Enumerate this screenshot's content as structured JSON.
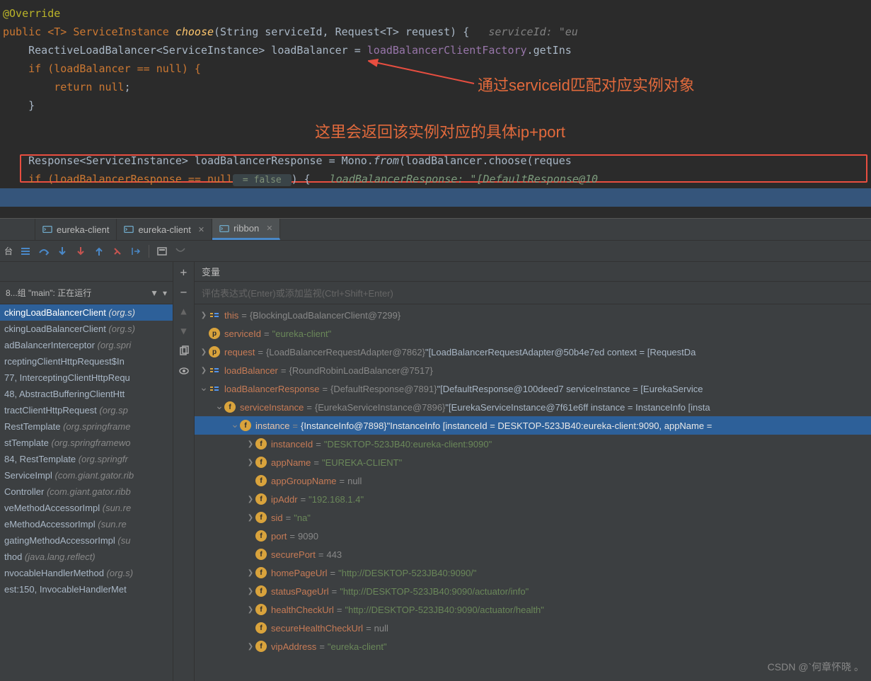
{
  "annotations": {
    "ann1": "通过serviceid匹配对应实例对象",
    "ann2": "这里会返回该实例对应的具体ip+port"
  },
  "code": {
    "override": "@Override",
    "line1_pre": "public <T> ServiceInstance ",
    "line1_method": "choose",
    "line1_post": "(String serviceId, Request<T> request) {",
    "line1_hint": "   serviceId: \"eu",
    "line2_pre": "    ReactiveLoadBalancer<ServiceInstance> loadBalancer = ",
    "line2_call": "loadBalancerClientFactory",
    "line2_post": ".getIns",
    "line3": "    if (loadBalancer == null) {",
    "line4_kw": "        return ",
    "line4_null": "null",
    "line4_end": ";",
    "line5": "    }",
    "line6_pre": "    Response<ServiceInstance> loadBalancerResponse = Mono.",
    "line6_from": "from",
    "line6_post": "(loadBalancer.choose(reques",
    "line7_pre": "    if (loadBalancerResponse == null",
    "line7_false": " = false ",
    "line7_post": ") {",
    "line7_hint": "   loadBalancerResponse: \"[DefaultResponse@10"
  },
  "tabs": {
    "t1": "eureka-client",
    "t2": "eureka-client",
    "t3": "ribbon"
  },
  "toolbar": {
    "console_label": "台"
  },
  "frames": {
    "header": "8...组 \"main\": 正在运行",
    "items": [
      {
        "fn": "ckingLoadBalancerClient",
        "loc": "(org.s)"
      },
      {
        "fn": "ckingLoadBalancerClient",
        "loc": "(org.s)"
      },
      {
        "fn": "adBalancerInterceptor",
        "loc": "(org.spri"
      },
      {
        "fn": "rceptingClientHttpRequest$In",
        "loc": ""
      },
      {
        "fn": "77, InterceptingClientHttpRequ",
        "loc": ""
      },
      {
        "fn": "48, AbstractBufferingClientHtt",
        "loc": ""
      },
      {
        "fn": "tractClientHttpRequest",
        "loc": "(org.sp"
      },
      {
        "fn": "RestTemplate",
        "loc": "(org.springframe"
      },
      {
        "fn": "stTemplate",
        "loc": "(org.springframewo"
      },
      {
        "fn": "84, RestTemplate",
        "loc": "(org.springfr"
      },
      {
        "fn": "ServiceImpl",
        "loc": "(com.giant.gator.rib"
      },
      {
        "fn": "Controller",
        "loc": "(com.giant.gator.ribb"
      },
      {
        "fn": "veMethodAccessorImpl",
        "loc": "(sun.re"
      },
      {
        "fn": "eMethodAccessorImpl",
        "loc": "(sun.re"
      },
      {
        "fn": "gatingMethodAccessorImpl",
        "loc": "(su"
      },
      {
        "fn": "thod",
        "loc": "(java.lang.reflect)"
      },
      {
        "fn": "nvocableHandlerMethod",
        "loc": "(org.s)"
      },
      {
        "fn": "est:150, InvocableHandlerMet",
        "loc": ""
      }
    ]
  },
  "variables_header": "变量",
  "eval_placeholder": "评估表达式(Enter)或添加监视(Ctrl+Shift+Enter)",
  "vars": [
    {
      "depth": 0,
      "chev": ">",
      "icon": "obj",
      "name": "this",
      "val_obj": "{BlockingLoadBalancerClient@7299}",
      "str": ""
    },
    {
      "depth": 0,
      "chev": "",
      "icon": "p",
      "name": "serviceId",
      "val_obj": "",
      "str": "\"eureka-client\""
    },
    {
      "depth": 0,
      "chev": ">",
      "icon": "p",
      "name": "request",
      "val_obj": "{LoadBalancerRequestAdapter@7862}",
      "str": " \"[LoadBalancerRequestAdapter@50b4e7ed context = [RequestDa"
    },
    {
      "depth": 0,
      "chev": ">",
      "icon": "obj",
      "name": "loadBalancer",
      "val_obj": "{RoundRobinLoadBalancer@7517}",
      "str": ""
    },
    {
      "depth": 0,
      "chev": "v",
      "icon": "obj",
      "name": "loadBalancerResponse",
      "val_obj": "{DefaultResponse@7891}",
      "str": " \"[DefaultResponse@100deed7 serviceInstance = [EurekaService"
    },
    {
      "depth": 1,
      "chev": "v",
      "icon": "f",
      "name": "serviceInstance",
      "val_obj": "{EurekaServiceInstance@7896}",
      "str": " \"[EurekaServiceInstance@7f61e6ff instance = InstanceInfo [insta"
    },
    {
      "depth": 2,
      "chev": "v",
      "icon": "f",
      "name": "instance",
      "val_obj": "{InstanceInfo@7898}",
      "str": " \"InstanceInfo [instanceId = DESKTOP-523JB40:eureka-client:9090, appName =",
      "selected": true
    },
    {
      "depth": 3,
      "chev": ">",
      "icon": "f",
      "name": "instanceId",
      "val_obj": "",
      "str": "\"DESKTOP-523JB40:eureka-client:9090\""
    },
    {
      "depth": 3,
      "chev": ">",
      "icon": "f",
      "name": "appName",
      "val_obj": "",
      "str": "\"EUREKA-CLIENT\""
    },
    {
      "depth": 3,
      "chev": "",
      "icon": "f",
      "name": "appGroupName",
      "val_obj": "null",
      "str": ""
    },
    {
      "depth": 3,
      "chev": ">",
      "icon": "f",
      "name": "ipAddr",
      "val_obj": "",
      "str": "\"192.168.1.4\""
    },
    {
      "depth": 3,
      "chev": ">",
      "icon": "f",
      "name": "sid",
      "val_obj": "",
      "str": "\"na\""
    },
    {
      "depth": 3,
      "chev": "",
      "icon": "f",
      "name": "port",
      "val_obj": "9090",
      "str": ""
    },
    {
      "depth": 3,
      "chev": "",
      "icon": "f",
      "name": "securePort",
      "val_obj": "443",
      "str": ""
    },
    {
      "depth": 3,
      "chev": ">",
      "icon": "f",
      "name": "homePageUrl",
      "val_obj": "",
      "str": "\"http://DESKTOP-523JB40:9090/\""
    },
    {
      "depth": 3,
      "chev": ">",
      "icon": "f",
      "name": "statusPageUrl",
      "val_obj": "",
      "str": "\"http://DESKTOP-523JB40:9090/actuator/info\""
    },
    {
      "depth": 3,
      "chev": ">",
      "icon": "f",
      "name": "healthCheckUrl",
      "val_obj": "",
      "str": "\"http://DESKTOP-523JB40:9090/actuator/health\""
    },
    {
      "depth": 3,
      "chev": "",
      "icon": "f",
      "name": "secureHealthCheckUrl",
      "val_obj": "null",
      "str": ""
    },
    {
      "depth": 3,
      "chev": ">",
      "icon": "f",
      "name": "vipAddress",
      "val_obj": "",
      "str": "\"eureka-client\""
    }
  ],
  "watermark": "CSDN @`何章怀晓 。"
}
